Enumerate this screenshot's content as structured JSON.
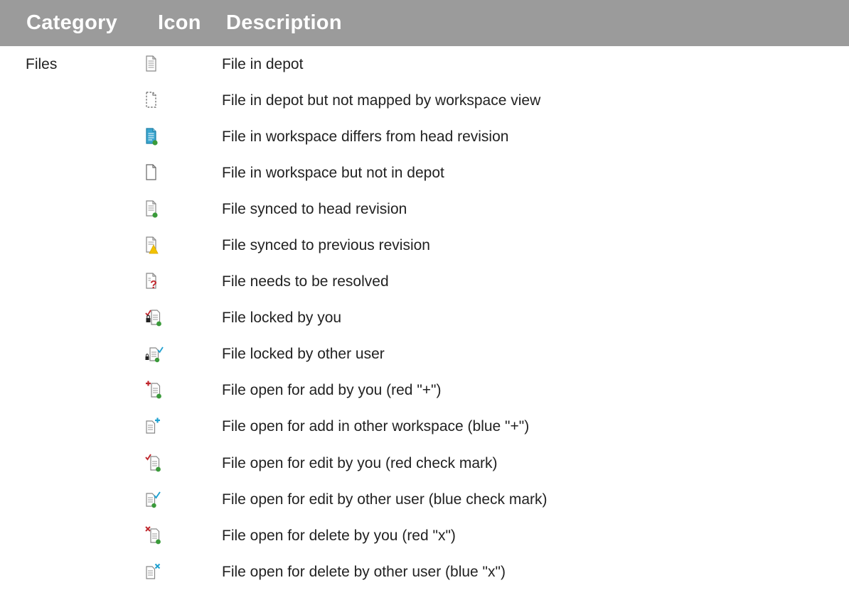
{
  "header": {
    "category": "Category",
    "icon": "Icon",
    "description": "Description"
  },
  "rows": [
    {
      "category": "Files",
      "icon": "file-in-depot-icon",
      "description": "File in depot"
    },
    {
      "category": "",
      "icon": "file-not-mapped-icon",
      "description": "File in depot but not mapped by workspace view"
    },
    {
      "category": "",
      "icon": "file-differs-from-head-icon",
      "description": "File in workspace differs from head revision"
    },
    {
      "category": "",
      "icon": "file-not-in-depot-icon",
      "description": "File in workspace but not in depot"
    },
    {
      "category": "",
      "icon": "file-synced-head-icon",
      "description": "File synced to head revision"
    },
    {
      "category": "",
      "icon": "file-synced-previous-icon",
      "description": "File synced to previous revision"
    },
    {
      "category": "",
      "icon": "file-needs-resolve-icon",
      "description": "File needs to be resolved"
    },
    {
      "category": "",
      "icon": "file-locked-by-you-icon",
      "description": "File locked by you"
    },
    {
      "category": "",
      "icon": "file-locked-by-other-icon",
      "description": "File locked by other user"
    },
    {
      "category": "",
      "icon": "file-add-by-you-icon",
      "description": "File open for add by you (red \"+\")"
    },
    {
      "category": "",
      "icon": "file-add-other-workspace-icon",
      "description": "File open for add in other workspace (blue \"+\")"
    },
    {
      "category": "",
      "icon": "file-edit-by-you-icon",
      "description": "File open for edit by you (red check mark)"
    },
    {
      "category": "",
      "icon": "file-edit-by-other-icon",
      "description": "File open for edit by other user (blue check mark)"
    },
    {
      "category": "",
      "icon": "file-delete-by-you-icon",
      "description": "File open for delete by you (red \"x\")"
    },
    {
      "category": "",
      "icon": "file-delete-by-other-icon",
      "description": "File open for delete by other user (blue \"x\")"
    }
  ],
  "colors": {
    "header_bg": "#9b9b9b",
    "red_marker": "#c0272d",
    "blue_marker": "#1ea0d0",
    "green_dot": "#3a9a3a",
    "yellow_warning": "#f2c200"
  }
}
